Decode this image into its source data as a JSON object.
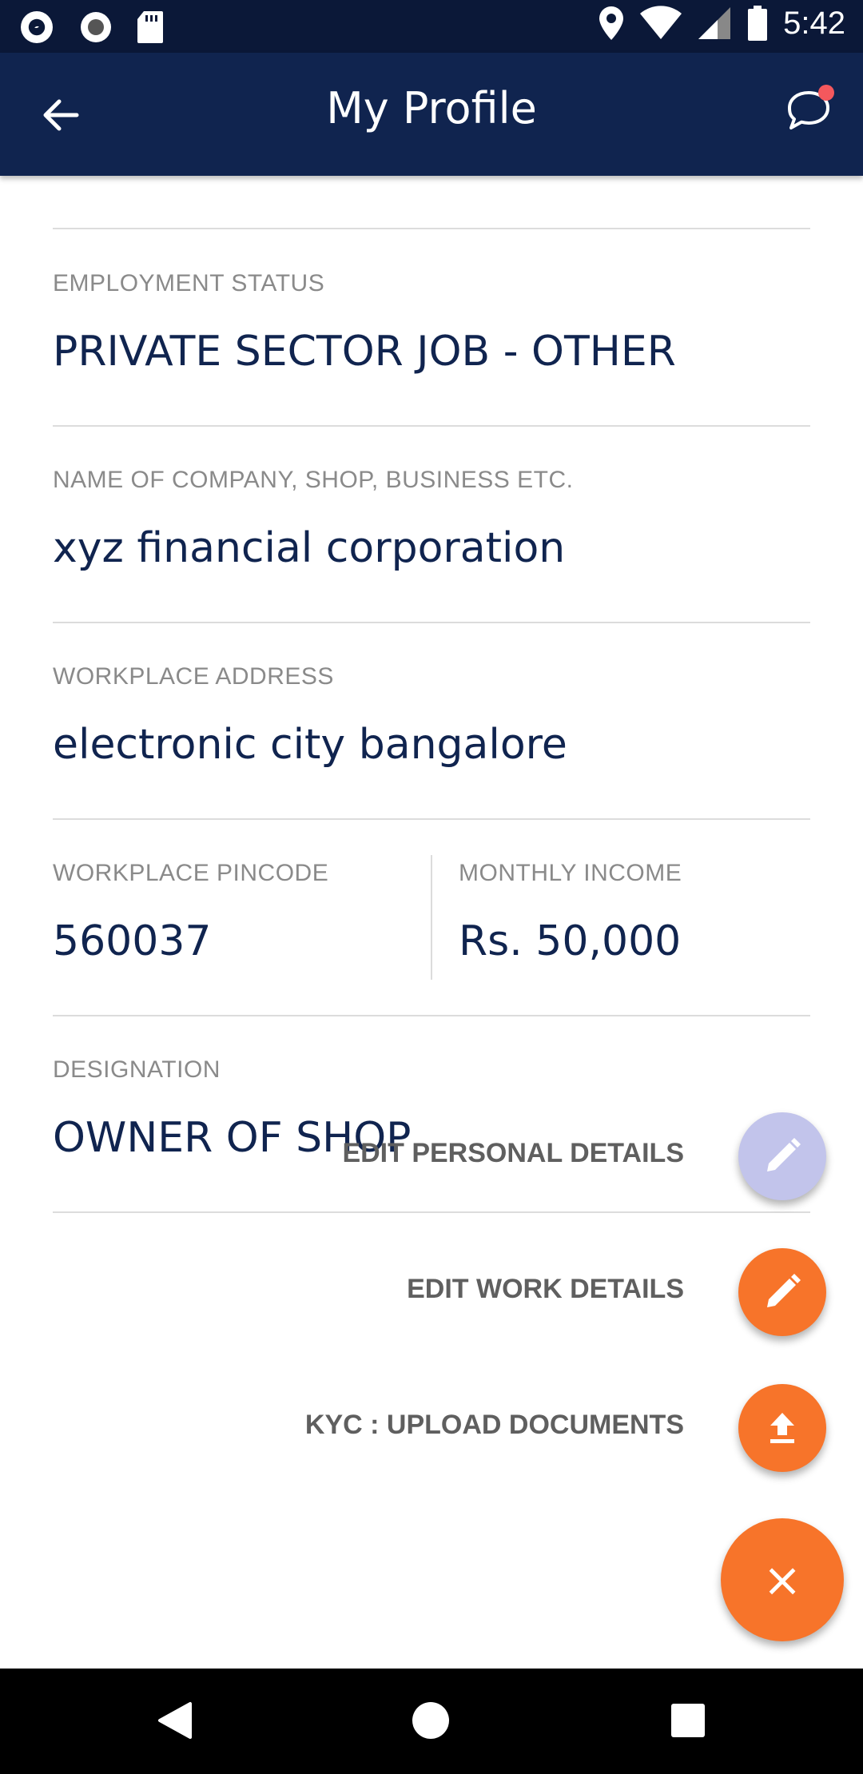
{
  "status_bar": {
    "time": "5:42",
    "icons_left": [
      "app-notification-icon",
      "record-icon",
      "sd-card-icon"
    ],
    "icons_right": [
      "location-icon",
      "wifi-icon",
      "signal-icon",
      "battery-icon"
    ]
  },
  "app_bar": {
    "title": "My Profile",
    "back_icon": "arrow-left-icon",
    "chat_icon": "chat-bubble-icon",
    "notification_dot_color": "#f4585d"
  },
  "fields": {
    "employment_status": {
      "label": "EMPLOYMENT STATUS",
      "value": "PRIVATE SECTOR JOB - OTHER"
    },
    "company_name": {
      "label": "NAME OF COMPANY, SHOP, BUSINESS ETC.",
      "value": "xyz financial corporation"
    },
    "workplace_address": {
      "label": "WORKPLACE ADDRESS",
      "value": "electronic city bangalore"
    },
    "workplace_pincode": {
      "label": "WORKPLACE PINCODE",
      "value": "560037"
    },
    "monthly_income": {
      "label": "MONTHLY INCOME",
      "value": "Rs. 50,000"
    },
    "designation": {
      "label": "DESIGNATION",
      "value": "OWNER OF SHOP"
    }
  },
  "speed_dial": {
    "edit_personal": {
      "label": "EDIT PERSONAL DETAILS",
      "icon": "pencil-icon"
    },
    "edit_work": {
      "label": "EDIT WORK DETAILS",
      "icon": "pencil-icon"
    },
    "kyc_upload": {
      "label": "KYC : UPLOAD DOCUMENTS",
      "icon": "upload-icon"
    },
    "close": {
      "label": "×",
      "icon": "close-icon"
    }
  },
  "colors": {
    "primary": "#10244f",
    "accent": "#f7742a",
    "disabled_fab": "#c2c4eb",
    "label_gray": "#8a8a8a"
  },
  "nav_bar": {
    "buttons": [
      "back-triangle-icon",
      "home-circle-icon",
      "recents-square-icon"
    ]
  }
}
